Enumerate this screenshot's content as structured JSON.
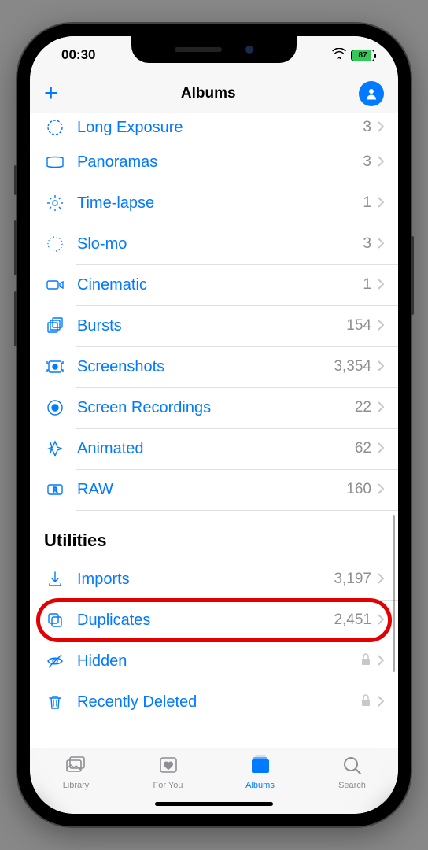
{
  "status": {
    "time": "00:30",
    "battery": "87"
  },
  "nav": {
    "title": "Albums"
  },
  "media_types": [
    {
      "icon": "long-exposure",
      "label": "Long Exposure",
      "count": "3",
      "partial": true
    },
    {
      "icon": "panorama",
      "label": "Panoramas",
      "count": "3"
    },
    {
      "icon": "timelapse",
      "label": "Time-lapse",
      "count": "1"
    },
    {
      "icon": "slomo",
      "label": "Slo-mo",
      "count": "3"
    },
    {
      "icon": "cinematic",
      "label": "Cinematic",
      "count": "1"
    },
    {
      "icon": "bursts",
      "label": "Bursts",
      "count": "154"
    },
    {
      "icon": "screenshots",
      "label": "Screenshots",
      "count": "3,354"
    },
    {
      "icon": "screenrec",
      "label": "Screen Recordings",
      "count": "22"
    },
    {
      "icon": "animated",
      "label": "Animated",
      "count": "62"
    },
    {
      "icon": "raw",
      "label": "RAW",
      "count": "160"
    }
  ],
  "utilities": {
    "header": "Utilities",
    "items": [
      {
        "icon": "imports",
        "label": "Imports",
        "count": "3,197",
        "locked": false
      },
      {
        "icon": "duplicates",
        "label": "Duplicates",
        "count": "2,451",
        "locked": false,
        "highlighted": true
      },
      {
        "icon": "hidden",
        "label": "Hidden",
        "count": "",
        "locked": true
      },
      {
        "icon": "deleted",
        "label": "Recently Deleted",
        "count": "",
        "locked": true
      }
    ]
  },
  "tabs": [
    {
      "id": "library",
      "label": "Library",
      "active": false
    },
    {
      "id": "foryou",
      "label": "For You",
      "active": false
    },
    {
      "id": "albums",
      "label": "Albums",
      "active": true
    },
    {
      "id": "search",
      "label": "Search",
      "active": false
    }
  ]
}
